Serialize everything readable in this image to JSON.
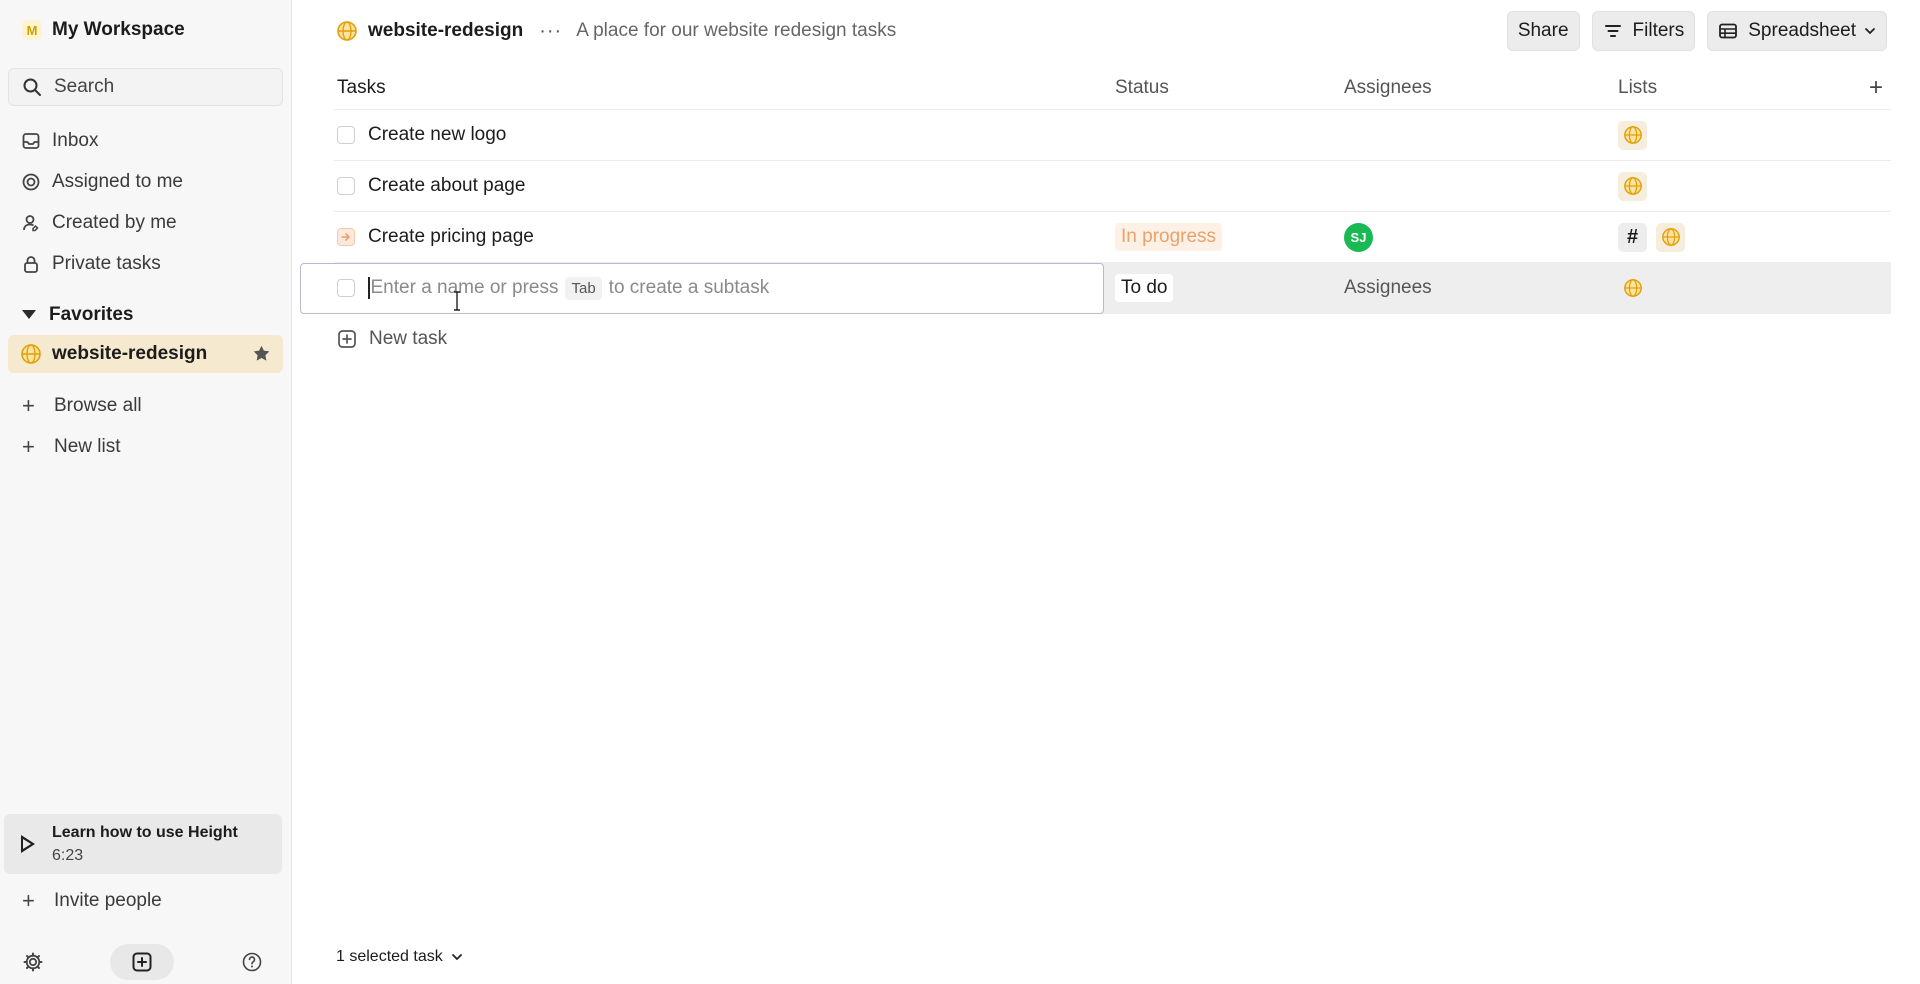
{
  "workspace": {
    "badge": "M",
    "name": "My Workspace"
  },
  "search": {
    "placeholder": "Search"
  },
  "nav": [
    {
      "label": "Inbox",
      "icon": "inbox-icon"
    },
    {
      "label": "Assigned to me",
      "icon": "target-icon"
    },
    {
      "label": "Created by me",
      "icon": "user-icon"
    },
    {
      "label": "Private tasks",
      "icon": "lock-icon"
    }
  ],
  "favorites": {
    "title": "Favorites",
    "items": [
      {
        "label": "website-redesign",
        "icon": "globe-icon"
      }
    ]
  },
  "sidebar_actions": {
    "browse_all": "Browse all",
    "new_list": "New list"
  },
  "learn": {
    "title": "Learn how to use Height",
    "duration": "6:23"
  },
  "invite": "Invite people",
  "header": {
    "list_name": "website-redesign",
    "more": "···",
    "description": "A place for our website redesign tasks",
    "share": "Share",
    "filters": "Filters",
    "view": "Spreadsheet"
  },
  "table": {
    "columns": {
      "tasks": "Tasks",
      "status": "Status",
      "assignees": "Assignees",
      "lists": "Lists"
    },
    "rows": [
      {
        "name": "Create new logo",
        "status": "",
        "assignee": "",
        "lists": [
          "globe"
        ]
      },
      {
        "name": "Create about page",
        "status": "",
        "assignee": "",
        "lists": [
          "globe"
        ]
      },
      {
        "name": "Create pricing page",
        "status": "In progress",
        "assignee": "SJ",
        "lists": [
          "hash",
          "globe"
        ]
      }
    ],
    "editing_row": {
      "placeholder_before": "Enter a name or press",
      "key": "Tab",
      "placeholder_after": "to create a subtask",
      "status": "To do",
      "assignees_placeholder": "Assignees"
    },
    "new_task": "New task",
    "hash_label": "#"
  },
  "footer": {
    "selected": "1 selected task"
  },
  "colors": {
    "accent_globe": "#e3a008",
    "avatar": "#19b954",
    "in_progress": "#e9a26b",
    "fav_bg": "#f5e9cf"
  }
}
